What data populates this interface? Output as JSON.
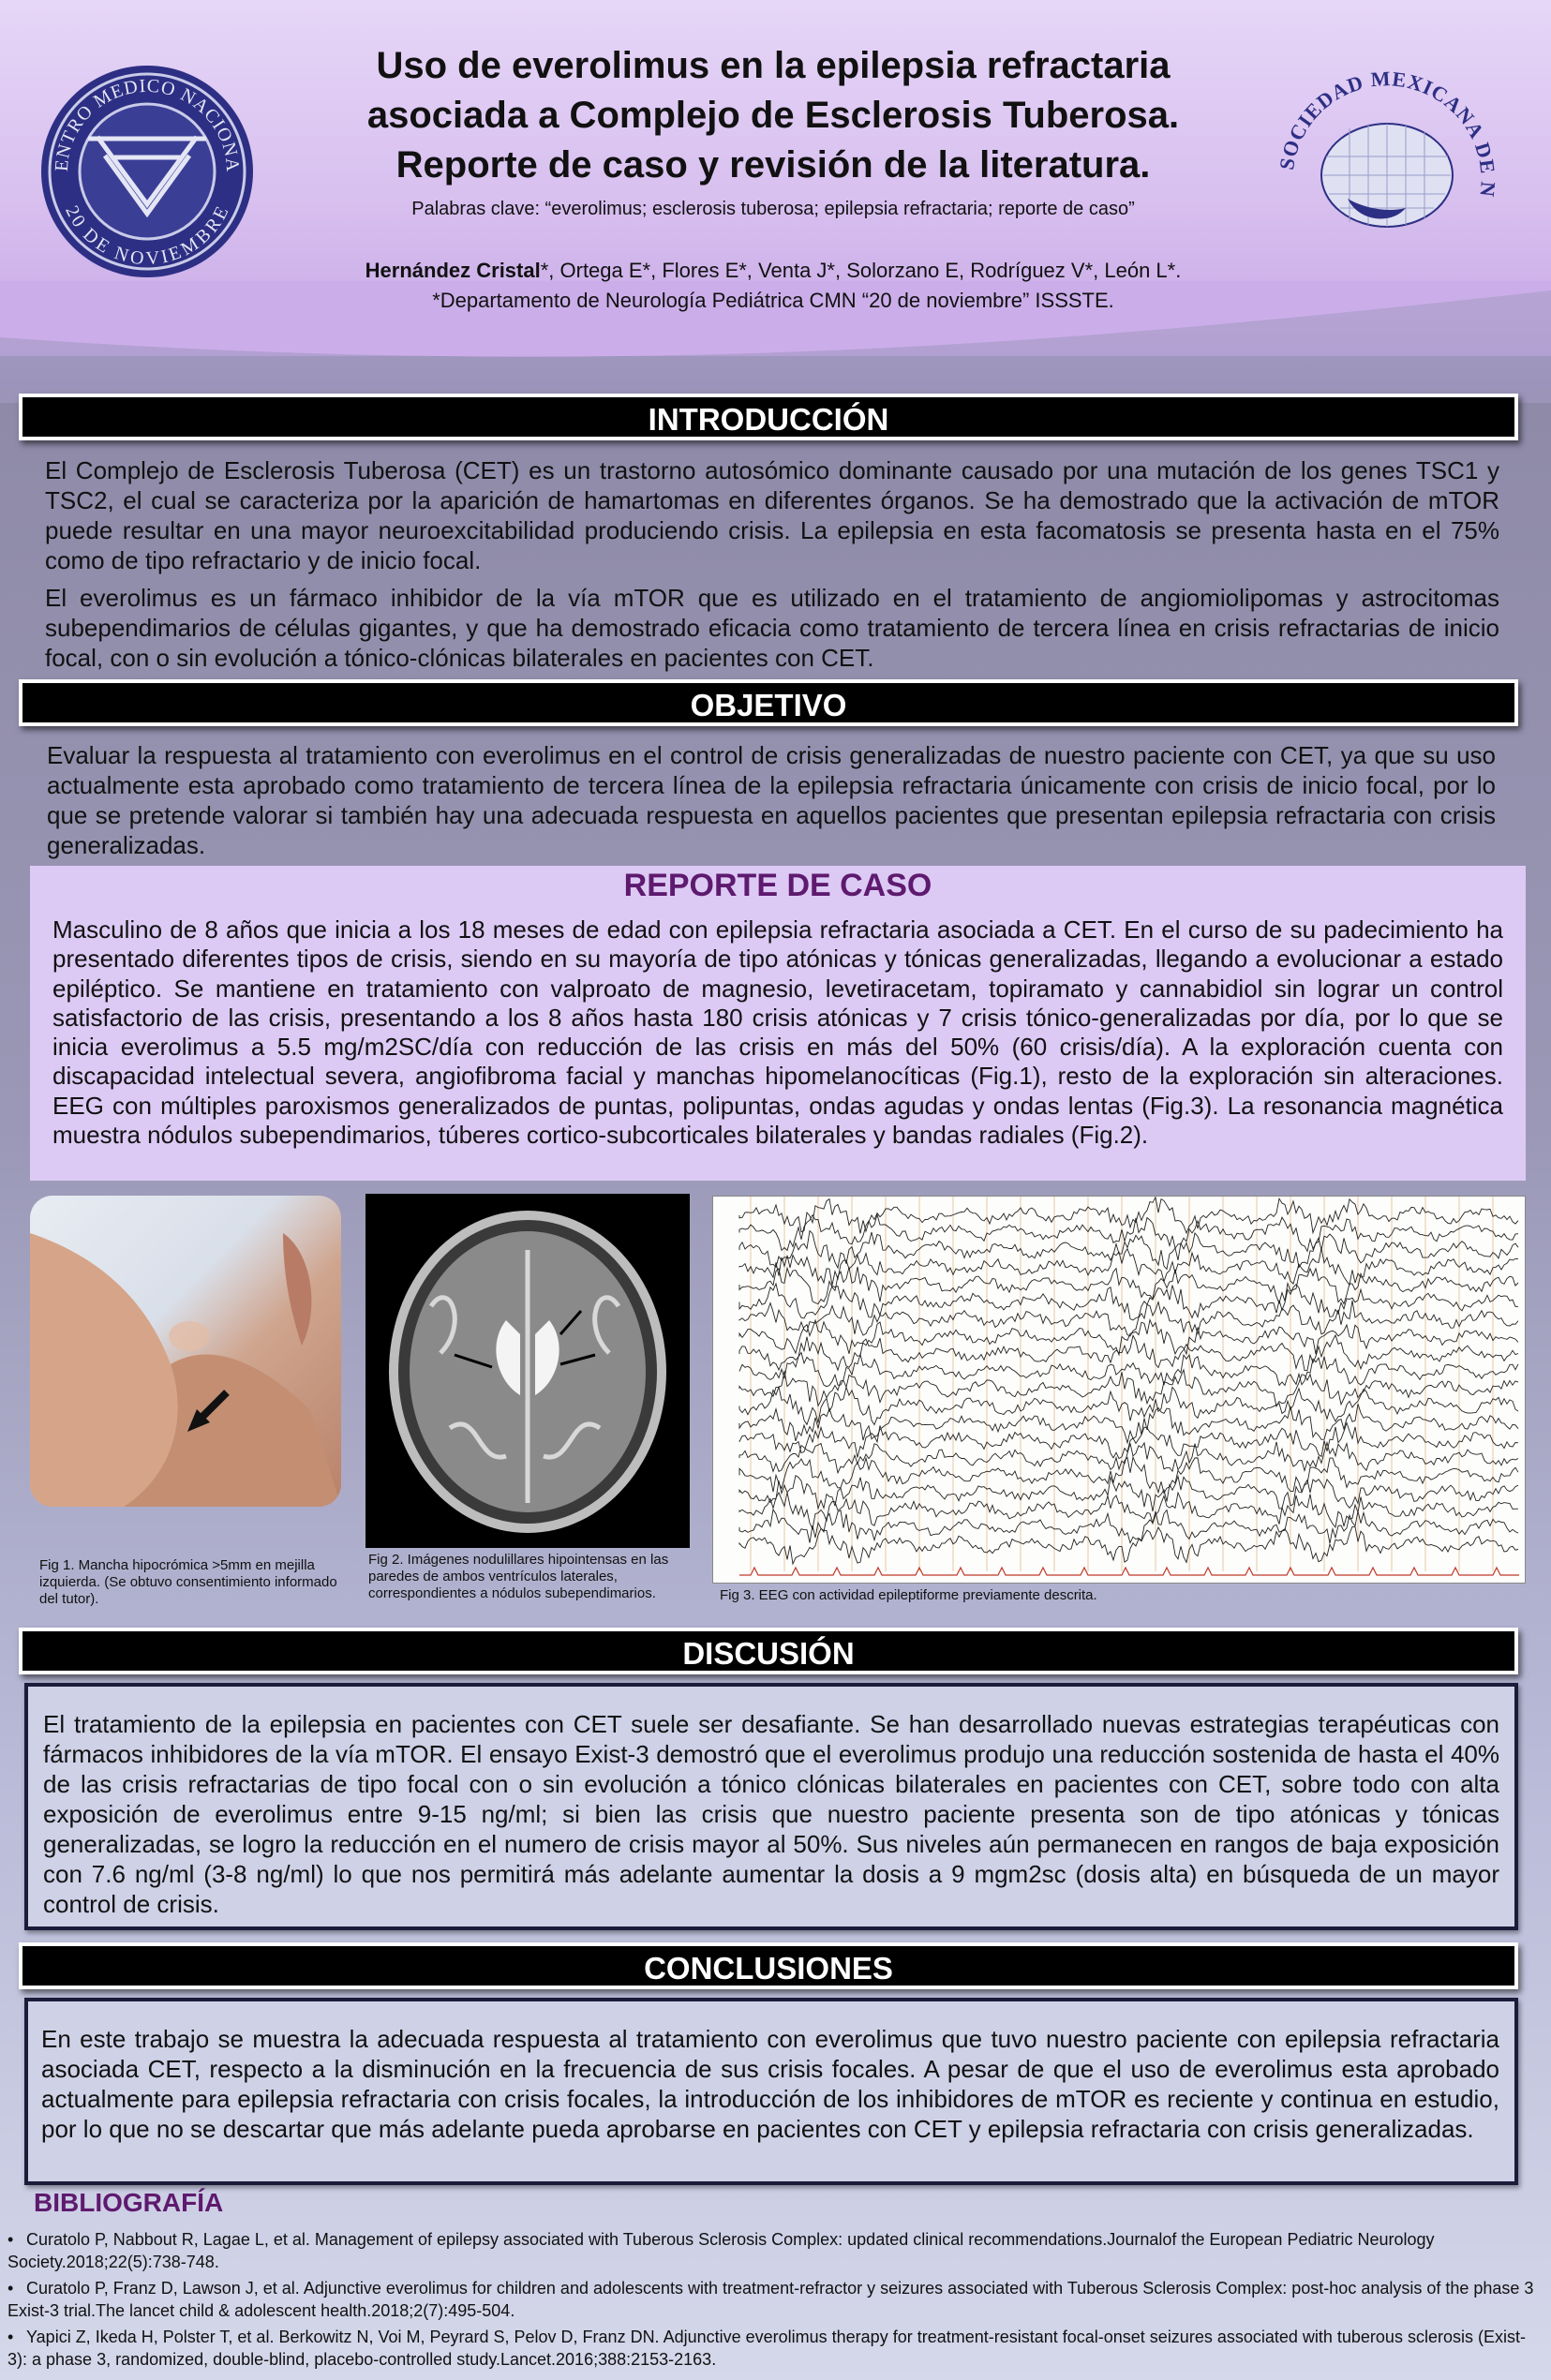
{
  "header": {
    "title_lines": [
      "Uso de everolimus en la epilepsia refractaria",
      "asociada a Complejo de Esclerosis Tuberosa.",
      "Reporte de caso y revisión de la literatura."
    ],
    "keywords": "Palabras clave: “everolimus; esclerosis tuberosa; epilepsia refractaria; reporte de caso”",
    "first_author": "Hernández Cristal",
    "authors_rest": "*, Ortega E*, Flores E*, Venta J*,  Solorzano E, Rodríguez V*, León L*.",
    "affiliation": "*Departamento de Neurología Pediátrica CMN “20 de noviembre” ISSSTE.",
    "logo_left_text_top": "CENTRO MEDICO NACIONAL",
    "logo_left_text_bottom": "20 DE NOVIEMBRE",
    "logo_right_text": "SOCIEDAD MEXICANA DE NEUROLOGÍA PEDIÁTRICA A.C."
  },
  "intro": {
    "heading": "INTRODUCCIÓN",
    "p1": "El Complejo de Esclerosis Tuberosa (CET) es un trastorno autosómico dominante causado por una mutación de los genes TSC1 y TSC2, el cual se caracteriza por la aparición de hamartomas en diferentes órganos. Se ha demostrado que la activación de mTOR puede resultar en una mayor neuroexcitabilidad produciendo crisis. La epilepsia en esta facomatosis se presenta hasta en el 75% como de tipo refractario y de inicio focal.",
    "p2": "El everolimus es un fármaco inhibidor de la vía mTOR que es utilizado en el tratamiento de angiomiolipomas y astrocitomas subependimarios de células gigantes, y que ha demostrado eficacia como tratamiento de tercera línea en crisis refractarias de inicio focal, con o sin evolución a tónico-clónicas bilaterales en pacientes con CET."
  },
  "objective": {
    "heading": "OBJETIVO",
    "text": "Evaluar la respuesta al tratamiento con everolimus en el control de crisis generalizadas de nuestro paciente con CET, ya que su uso actualmente esta aprobado como tratamiento de tercera línea de la epilepsia refractaria únicamente con crisis de inicio focal, por lo que se pretende valorar si también hay una adecuada respuesta en aquellos pacientes que presentan epilepsia refractaria con crisis generalizadas."
  },
  "case": {
    "heading": "REPORTE DE CASO",
    "text": "Masculino de 8 años que inicia a los 18 meses de edad con epilepsia refractaria asociada a CET. En el curso de su padecimiento ha presentado diferentes tipos de crisis, siendo en su mayoría de tipo atónicas y tónicas generalizadas, llegando a evolucionar a estado epiléptico. Se mantiene en tratamiento con valproato de magnesio, levetiracetam, topiramato y cannabidiol sin lograr un control satisfactorio de las crisis, presentando a los 8 años hasta 180 crisis atónicas y 7 crisis tónico-generalizadas por día, por lo que se inicia everolimus a 5.5 mg/m2SC/día con reducción de las crisis en más del 50% (60 crisis/día). A la exploración cuenta con discapacidad intelectual severa, angiofibroma facial y manchas hipomelanocíticas (Fig.1), resto de la exploración sin alteraciones. EEG con múltiples paroxismos generalizados de puntas, polipuntas, ondas agudas y ondas lentas (Fig.3). La resonancia magnética muestra nódulos subependimarios, túberes cortico-subcorticales bilaterales y bandas radiales (Fig.2)."
  },
  "figures": {
    "fig1_caption": "Fig 1. Mancha hipocrómica >5mm en mejilla izquierda. (Se obtuvo consentimiento informado del tutor).",
    "fig2_caption": "Fig 2. Imágenes nodulillares hipointensas en las paredes de ambos ventrículos laterales, correspondientes a nódulos subependimarios.",
    "fig3_caption": "Fig 3. EEG con actividad epileptiforme previamente descrita."
  },
  "discussion": {
    "heading": "DISCUSIÓN",
    "text": "El tratamiento de la epilepsia en pacientes con CET suele ser desafiante. Se han desarrollado nuevas estrategias terapéuticas con fármacos inhibidores de la vía mTOR. El ensayo Exist-3 demostró que el everolimus produjo una reducción sostenida de hasta el 40% de las crisis refractarias de tipo focal con o sin evolución a tónico clónicas bilaterales en pacientes con CET, sobre todo con alta exposición de everolimus entre 9-15 ng/ml; si bien las crisis que nuestro paciente presenta son de tipo atónicas y tónicas generalizadas, se logro la reducción en el numero de crisis mayor al 50%. Sus niveles aún permanecen en rangos de baja exposición con 7.6 ng/ml (3-8 ng/ml) lo que nos permitirá más adelante aumentar la dosis a 9 mgm2sc (dosis alta) en búsqueda de un mayor control de crisis."
  },
  "conclusions": {
    "heading": "CONCLUSIONES",
    "text": "En este trabajo se muestra la adecuada respuesta al tratamiento con everolimus que tuvo nuestro paciente con epilepsia refractaria asociada CET, respecto a la disminución en la frecuencia de sus crisis focales. A pesar de que el uso de everolimus esta aprobado actualmente para epilepsia refractaria con crisis focales, la introducción de los inhibidores de mTOR es reciente y continua en estudio, por lo que no se descartar que más adelante pueda aprobarse en pacientes con CET y epilepsia refractaria con crisis generalizadas."
  },
  "bibliography": {
    "heading": "BIBLIOGRAFÍA",
    "items": [
      "Curatolo P, Nabbout R, Lagae L, et al. Management of epilepsy associated with Tuberous Sclerosis Complex: updated clinical recommendations.Journalof the European Pediatric Neurology Society.2018;22(5):738-748.",
      "Curatolo P, Franz D, Lawson J, et al. Adjunctive everolimus for children and adolescents with treatment-refractor y seizures associated with Tuberous Sclerosis Complex: post-hoc analysis of the phase 3 Exist-3 trial.The lancet child & adolescent health.2018;2(7):495-504.",
      "Yapici Z, Ikeda H, Polster T, et al. Berkowitz N, Voi M, Peyrard S, Pelov D, Franz DN. Adjunctive everolimus therapy for treatment-resistant focal-onset seizures associated with tuberous sclerosis (Exist-3): a phase 3, randomized, double-blind, placebo-controlled study.Lancet.2016;388:2153-2163."
    ]
  },
  "colors": {
    "accent": "#5e1a6e",
    "header_bg": "#d8c0ef",
    "case_bg": "#dccaf5"
  }
}
